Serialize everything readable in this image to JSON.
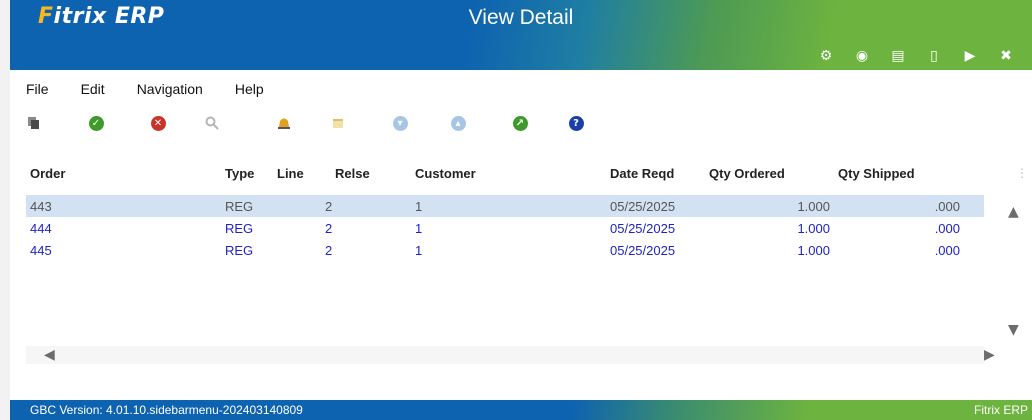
{
  "app": {
    "logo_prefix": "F",
    "logo_rest": "itrix ERP",
    "title": "View Detail"
  },
  "header_icons": [
    {
      "name": "gear-icon",
      "glyph": "⚙"
    },
    {
      "name": "target-icon",
      "glyph": "◉"
    },
    {
      "name": "document-icon",
      "glyph": "▤"
    },
    {
      "name": "new-document-icon",
      "glyph": "▯"
    },
    {
      "name": "play-icon",
      "glyph": "▶"
    },
    {
      "name": "close-circle-icon",
      "glyph": "✖"
    }
  ],
  "menu": {
    "file": "File",
    "edit": "Edit",
    "navigation": "Navigation",
    "help": "Help"
  },
  "table": {
    "headers": {
      "order": "Order",
      "type": "Type",
      "line": "Line",
      "relse": "Relse",
      "customer": "Customer",
      "date_reqd": "Date Reqd",
      "qty_ordered": "Qty Ordered",
      "qty_shipped": "Qty Shipped"
    },
    "rows": [
      {
        "order": "443",
        "type": "REG",
        "line": "2",
        "relse": "1",
        "customer": "",
        "date_reqd": "05/25/2025",
        "qty_ordered": "1.000",
        "qty_shipped": ".000"
      },
      {
        "order": "444",
        "type": "REG",
        "line": "2",
        "relse": "1",
        "customer": "",
        "date_reqd": "05/25/2025",
        "qty_ordered": "1.000",
        "qty_shipped": ".000"
      },
      {
        "order": "445",
        "type": "REG",
        "line": "2",
        "relse": "1",
        "customer": "",
        "date_reqd": "05/25/2025",
        "qty_ordered": "1.000",
        "qty_shipped": ".000"
      }
    ]
  },
  "status": {
    "version": "GBC Version: 4.01.10.sidebarmenu-202403140809",
    "brand": "Fitrix ERP"
  },
  "colors": {
    "header_blue": "#0e63b0",
    "header_green": "#6db33f",
    "selected_row": "#d3e2f2",
    "link_blue": "#1f22c8"
  }
}
